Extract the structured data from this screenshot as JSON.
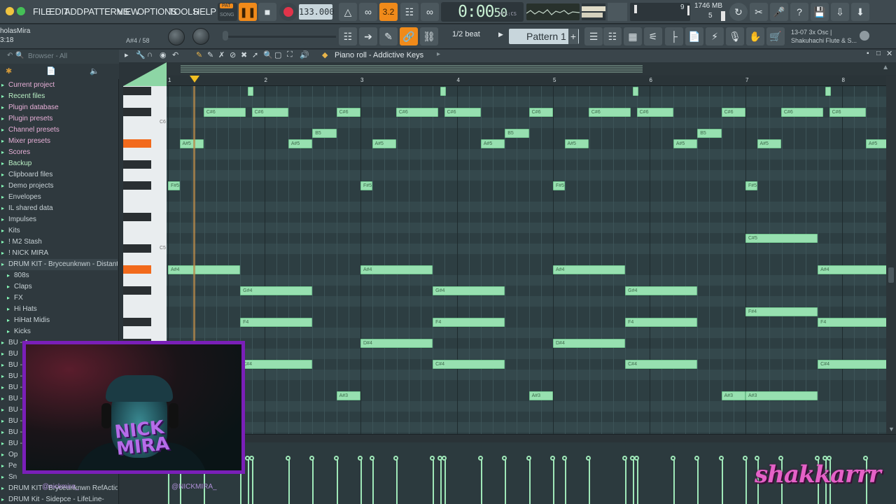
{
  "menu": {
    "items": [
      "FILE",
      "EDIT",
      "ADD",
      "PATTERNS",
      "VIEW",
      "OPTIONS",
      "TOOLS",
      "HELP"
    ]
  },
  "transport": {
    "pat_label": "PAT",
    "song_label": "SONG",
    "tempo": "133.000",
    "time": "0:00",
    "time_sub": "50",
    "time_unit": "M:S:CS",
    "cpu": "9",
    "memory": "1746 MB",
    "polyphony": "5",
    "pattern_indicator": "3.2"
  },
  "hint_bar": {
    "project_name": "holasMira",
    "time_info": "3:18",
    "note_info": "A#4 / 58",
    "snap": "1/2 beat",
    "pattern": "Pattern 1",
    "plugin_line1": "13-07  3x Osc |",
    "plugin_line2": "Shakuhachi Flute & S..."
  },
  "browser": {
    "header": "Browser - All",
    "items": [
      {
        "label": "Current project",
        "color": "pink"
      },
      {
        "label": "Recent files",
        "color": "green"
      },
      {
        "label": "Plugin database",
        "color": "pink"
      },
      {
        "label": "Plugin presets",
        "color": "pink"
      },
      {
        "label": "Channel presets",
        "color": "pink"
      },
      {
        "label": "Mixer presets",
        "color": "pink"
      },
      {
        "label": "Scores",
        "color": "pink"
      },
      {
        "label": "Backup",
        "color": "green"
      },
      {
        "label": "Clipboard files",
        "color": "plain"
      },
      {
        "label": "Demo projects",
        "color": "plain"
      },
      {
        "label": "Envelopes",
        "color": "plain"
      },
      {
        "label": "IL shared data",
        "color": "plain"
      },
      {
        "label": "Impulses",
        "color": "plain"
      },
      {
        "label": "Kits",
        "color": "plain"
      },
      {
        "label": "! M2 Stash",
        "color": "plain"
      },
      {
        "label": "! NICK MIRA",
        "color": "plain"
      },
      {
        "label": "DRUM KIT - Bryceunknwn - Distant",
        "color": "plain"
      },
      {
        "label": "808s",
        "color": "plain"
      },
      {
        "label": "Claps",
        "color": "plain"
      },
      {
        "label": "FX",
        "color": "plain"
      },
      {
        "label": "Hi Hats",
        "color": "plain"
      },
      {
        "label": "HiHat Midis",
        "color": "plain"
      },
      {
        "label": "Kicks",
        "color": "plain"
      },
      {
        "label": "BU - A",
        "color": "plain"
      },
      {
        "label": "BU",
        "color": "plain"
      },
      {
        "label": "BU - I",
        "color": "plain"
      },
      {
        "label": "BU - I",
        "color": "plain"
      },
      {
        "label": "BU - C",
        "color": "plain"
      },
      {
        "label": "BU - P",
        "color": "plain"
      },
      {
        "label": "BU - S",
        "color": "plain"
      },
      {
        "label": "BU - S",
        "color": "plain"
      },
      {
        "label": "BU - T",
        "color": "plain"
      },
      {
        "label": "BU - T",
        "color": "plain"
      },
      {
        "label": "Op",
        "color": "plain"
      },
      {
        "label": "Pe",
        "color": "plain"
      },
      {
        "label": "Sn",
        "color": "plain"
      },
      {
        "label": "DRUM KIT - Bryceunknwn RefAction",
        "color": "plain"
      },
      {
        "label": "DRUM Kit - Sidepce - LifeLine-",
        "color": "plain"
      }
    ]
  },
  "piano_roll": {
    "title": "Piano roll - Addictive Keys",
    "ruler": [
      "1",
      "2",
      "3",
      "4",
      "5",
      "6",
      "7",
      "8"
    ],
    "key_labels": [
      "C6",
      "C5"
    ],
    "notes": [
      {
        "label": "",
        "bar": 1.83,
        "len": 0.06,
        "row": 0
      },
      {
        "label": "",
        "bar": 3.83,
        "len": 0.06,
        "row": 0
      },
      {
        "label": "",
        "bar": 5.83,
        "len": 0.06,
        "row": 0
      },
      {
        "label": "",
        "bar": 7.83,
        "len": 0.06,
        "row": 0
      },
      {
        "label": "C#6",
        "bar": 1.37,
        "len": 0.44,
        "row": 2
      },
      {
        "label": "C#6",
        "bar": 1.87,
        "len": 0.38,
        "row": 2
      },
      {
        "label": "C#6",
        "bar": 2.75,
        "len": 0.25,
        "row": 2
      },
      {
        "label": "C#6",
        "bar": 3.37,
        "len": 0.44,
        "row": 2
      },
      {
        "label": "C#6",
        "bar": 3.87,
        "len": 0.38,
        "row": 2
      },
      {
        "label": "C#6",
        "bar": 4.75,
        "len": 0.25,
        "row": 2
      },
      {
        "label": "C#6",
        "bar": 5.37,
        "len": 0.44,
        "row": 2
      },
      {
        "label": "C#6",
        "bar": 5.87,
        "len": 0.38,
        "row": 2
      },
      {
        "label": "C#6",
        "bar": 6.75,
        "len": 0.25,
        "row": 2
      },
      {
        "label": "C#6",
        "bar": 7.37,
        "len": 0.44,
        "row": 2
      },
      {
        "label": "C#6",
        "bar": 7.87,
        "len": 0.38,
        "row": 2
      },
      {
        "label": "B5",
        "bar": 2.5,
        "len": 0.25,
        "row": 4
      },
      {
        "label": "B5",
        "bar": 4.5,
        "len": 0.25,
        "row": 4
      },
      {
        "label": "B5",
        "bar": 6.5,
        "len": 0.25,
        "row": 4
      },
      {
        "label": "A#5",
        "bar": 1.12,
        "len": 0.25,
        "row": 5
      },
      {
        "label": "A#5",
        "bar": 2.25,
        "len": 0.25,
        "row": 5
      },
      {
        "label": "A#5",
        "bar": 3.12,
        "len": 0.25,
        "row": 5
      },
      {
        "label": "A#5",
        "bar": 4.25,
        "len": 0.25,
        "row": 5
      },
      {
        "label": "A#5",
        "bar": 5.12,
        "len": 0.25,
        "row": 5
      },
      {
        "label": "A#5",
        "bar": 6.25,
        "len": 0.25,
        "row": 5
      },
      {
        "label": "A#5",
        "bar": 7.12,
        "len": 0.25,
        "row": 5
      },
      {
        "label": "A#5",
        "bar": 8.25,
        "len": 0.25,
        "row": 5
      },
      {
        "label": "F#5",
        "bar": 1.0,
        "len": 0.12,
        "row": 9
      },
      {
        "label": "F#5",
        "bar": 3.0,
        "len": 0.12,
        "row": 9
      },
      {
        "label": "F#5",
        "bar": 5.0,
        "len": 0.12,
        "row": 9
      },
      {
        "label": "F#5",
        "bar": 7.0,
        "len": 0.12,
        "row": 9
      },
      {
        "label": "C#5",
        "bar": 7.0,
        "len": 0.75,
        "row": 14
      },
      {
        "label": "A#4",
        "bar": 1.0,
        "len": 0.75,
        "row": 17
      },
      {
        "label": "A#4",
        "bar": 3.0,
        "len": 0.75,
        "row": 17
      },
      {
        "label": "A#4",
        "bar": 5.0,
        "len": 0.75,
        "row": 17
      },
      {
        "label": "A#4",
        "bar": 7.75,
        "len": 0.75,
        "row": 17
      },
      {
        "label": "G#4",
        "bar": 1.75,
        "len": 0.75,
        "row": 19
      },
      {
        "label": "G#4",
        "bar": 3.75,
        "len": 0.75,
        "row": 19
      },
      {
        "label": "G#4",
        "bar": 5.75,
        "len": 0.75,
        "row": 19
      },
      {
        "label": "F#4",
        "bar": 7.0,
        "len": 0.75,
        "row": 21
      },
      {
        "label": "F4",
        "bar": 1.75,
        "len": 0.75,
        "row": 22
      },
      {
        "label": "F4",
        "bar": 3.75,
        "len": 0.75,
        "row": 22
      },
      {
        "label": "F4",
        "bar": 5.75,
        "len": 0.75,
        "row": 22
      },
      {
        "label": "F4",
        "bar": 7.75,
        "len": 0.75,
        "row": 22
      },
      {
        "label": "D#4",
        "bar": 3.0,
        "len": 0.75,
        "row": 24
      },
      {
        "label": "D#4",
        "bar": 5.0,
        "len": 0.75,
        "row": 24
      },
      {
        "label": "C#4",
        "bar": 1.75,
        "len": 0.75,
        "row": 26
      },
      {
        "label": "C#4",
        "bar": 3.75,
        "len": 0.75,
        "row": 26
      },
      {
        "label": "C#4",
        "bar": 5.75,
        "len": 0.75,
        "row": 26
      },
      {
        "label": "C#4",
        "bar": 7.75,
        "len": 0.75,
        "row": 26
      },
      {
        "label": "A#3",
        "bar": 2.75,
        "len": 0.25,
        "row": 29
      },
      {
        "label": "A#3",
        "bar": 4.75,
        "len": 0.25,
        "row": 29
      },
      {
        "label": "A#3",
        "bar": 6.75,
        "len": 0.25,
        "row": 29
      },
      {
        "label": "A#3",
        "bar": 7.0,
        "len": 0.75,
        "row": 29
      }
    ]
  },
  "overlay": {
    "cam_logo": "NICK\nMIRA",
    "watermark": "shakkarrr",
    "social_handle": "@nickmira_",
    "social_handle2": "@NICKMIRA_"
  },
  "colors": {
    "note": "#97e0b0",
    "accent": "#f08a1a",
    "highlight_key": "#f26a1c",
    "webcam_border": "#7a1fb8",
    "watermark": "#e561c7"
  }
}
